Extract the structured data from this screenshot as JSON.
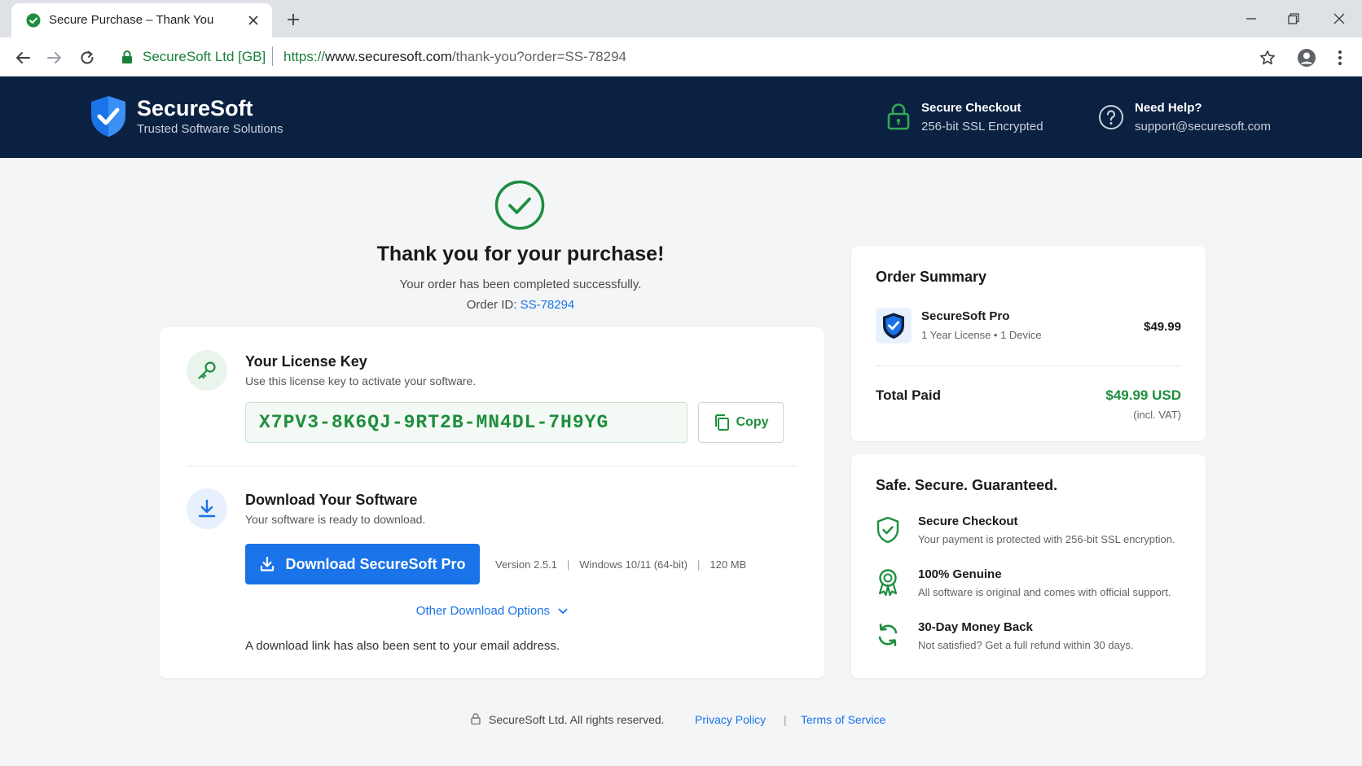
{
  "browser": {
    "tab_title": "Secure Purchase – Thank You",
    "address_org": "SecureSoft Ltd [GB]",
    "url_scheme": "https://",
    "url_host": "www.securesoft.com",
    "url_path": "/thank-you?order=SS-78294"
  },
  "header": {
    "brand_name": "SecureSoft",
    "tagline": "Trusted Software Solutions",
    "secure_title": "Secure Checkout",
    "secure_sub": "256-bit SSL Encrypted",
    "help_title": "Need Help?",
    "help_email": "support@securesoft.com"
  },
  "confirmation": {
    "title": "Thank you for your purchase!",
    "subtitle": "Your order has been completed successfully.",
    "order_label": "Order ID: ",
    "order_id": "SS-78294"
  },
  "license": {
    "title": "Your License Key",
    "subtitle": "Use this license key to activate your software.",
    "key": "X7PV3-8K6QJ-9RT2B-MN4DL-7H9YG",
    "copy_label": "Copy"
  },
  "download": {
    "title": "Download Your Software",
    "subtitle": "Your software is ready to download.",
    "button_label": "Download SecureSoft Pro",
    "version": "Version 2.5.1",
    "platform": "Windows 10/11 (64-bit)",
    "size": "120 MB",
    "other_options": "Other Download Options",
    "email_note": "A download link has also been sent to your email address."
  },
  "summary": {
    "title": "Order Summary",
    "product_name": "SecureSoft Pro",
    "product_meta": "1 Year License  •  1 Device",
    "product_price": "$49.99",
    "total_label": "Total Paid",
    "total_value": "$49.99 USD",
    "total_vat": "(incl. VAT)"
  },
  "guarantee": {
    "title": "Safe. Secure. Guaranteed.",
    "items": [
      {
        "title": "Secure Checkout",
        "desc": "Your payment is protected with 256-bit SSL encryption.",
        "icon": "shield-check-icon"
      },
      {
        "title": "100% Genuine",
        "desc": "All software is original and comes with official support.",
        "icon": "award-ribbon-icon"
      },
      {
        "title": "30-Day Money Back",
        "desc": "Not satisfied? Get a full refund within 30 days.",
        "icon": "refresh-icon"
      }
    ]
  },
  "footer": {
    "copyright": "SecureSoft Ltd.  All rights reserved.",
    "privacy": "Privacy Policy",
    "separator": "|",
    "terms": "Terms of Service"
  },
  "colors": {
    "header_bg": "#0b2141",
    "accent_blue": "#1a73e8",
    "success_green": "#1e8e3e",
    "page_bg": "#f4f5f7"
  }
}
